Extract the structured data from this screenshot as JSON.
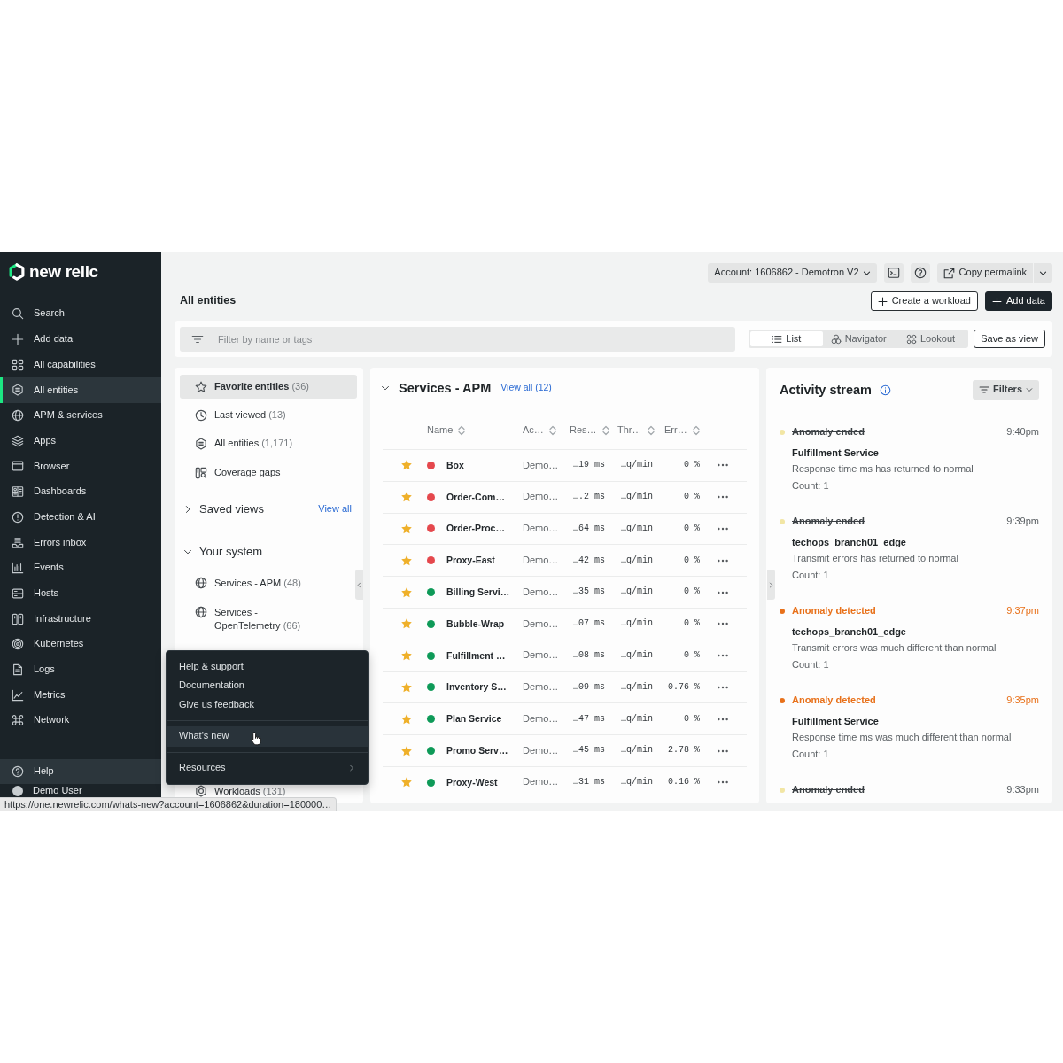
{
  "sidebar": {
    "brand": "new relic",
    "items": [
      {
        "label": "Search",
        "selected": false
      },
      {
        "label": "Add data",
        "selected": false
      },
      {
        "label": "All capabilities",
        "selected": false
      },
      {
        "label": "All entities",
        "selected": true
      },
      {
        "label": "APM & services",
        "selected": false
      },
      {
        "label": "Apps",
        "selected": false
      },
      {
        "label": "Browser",
        "selected": false
      },
      {
        "label": "Dashboards",
        "selected": false
      },
      {
        "label": "Detection & AI",
        "selected": false
      },
      {
        "label": "Errors inbox",
        "selected": false
      },
      {
        "label": "Events",
        "selected": false
      },
      {
        "label": "Hosts",
        "selected": false
      },
      {
        "label": "Infrastructure",
        "selected": false
      },
      {
        "label": "Kubernetes",
        "selected": false
      },
      {
        "label": "Logs",
        "selected": false
      },
      {
        "label": "Metrics",
        "selected": false
      },
      {
        "label": "Network",
        "selected": false
      }
    ],
    "footer": [
      {
        "label": "Help",
        "expanded": true
      },
      {
        "label": "Demo User",
        "expanded": false
      }
    ]
  },
  "top_bar": {
    "account": "Account: 1606862 - Demotron V2",
    "permalink": "Copy permalink"
  },
  "page": {
    "title": "All entities",
    "actions": [
      {
        "label": "Create a workload",
        "kind": "outline"
      },
      {
        "label": "Add data",
        "kind": "primary"
      }
    ]
  },
  "filter_bar": {
    "placeholder": "Filter by name or tags",
    "views": [
      {
        "label": "List",
        "selected": true
      },
      {
        "label": "Navigator",
        "selected": false
      },
      {
        "label": "Lookout",
        "selected": false
      }
    ],
    "save_button": "Save as view"
  },
  "entity_filters": {
    "quick": [
      {
        "label": "Favorite entities",
        "count": "(36)",
        "selected": true
      },
      {
        "label": "Last viewed",
        "count": "(13)",
        "selected": false
      },
      {
        "label": "All entities",
        "count": "(1,171)",
        "selected": false
      },
      {
        "label": "Coverage gaps",
        "selected": false
      }
    ],
    "sections": [
      {
        "title": "Saved views",
        "expanded": false,
        "link": "View all"
      },
      {
        "title": "Your system",
        "expanded": true,
        "items": [
          {
            "label": "Services - APM",
            "count": "(48)"
          },
          {
            "label": "Services - OpenTelemetry",
            "count": "(66)"
          },
          {
            "label": "Workloads",
            "count": "(131)"
          }
        ]
      }
    ]
  },
  "services": {
    "title": "Services - APM",
    "link": "View all (12)",
    "expanded": true,
    "columns": [
      "Name",
      "Ac…",
      "Res…",
      "Thr…",
      "Err…"
    ],
    "rows": [
      {
        "favorite": true,
        "color": "#e5484d",
        "name": "Box",
        "account": "Demo…",
        "response": "…19 ms",
        "throughput": "…q/min",
        "error": "0 %"
      },
      {
        "favorite": true,
        "color": "#e5484d",
        "name": "Order-Com…",
        "account": "Demo…",
        "response": "….2 ms",
        "throughput": "…q/min",
        "error": "0 %"
      },
      {
        "favorite": true,
        "color": "#e5484d",
        "name": "Order-Proc…",
        "account": "Demo…",
        "response": "…64 ms",
        "throughput": "…q/min",
        "error": "0 %"
      },
      {
        "favorite": true,
        "color": "#e5484d",
        "name": "Proxy-East",
        "account": "Demo…",
        "response": "…42 ms",
        "throughput": "…q/min",
        "error": "0 %"
      },
      {
        "favorite": true,
        "color": "#0e9a58",
        "name": "Billing Servi…",
        "account": "Demo…",
        "response": "…35 ms",
        "throughput": "…q/min",
        "error": "0 %"
      },
      {
        "favorite": true,
        "color": "#0e9a58",
        "name": "Bubble-Wrap",
        "account": "Demo…",
        "response": "…07 ms",
        "throughput": "…q/min",
        "error": "0 %"
      },
      {
        "favorite": true,
        "color": "#0e9a58",
        "name": "Fulfillment …",
        "account": "Demo…",
        "response": "…08 ms",
        "throughput": "…q/min",
        "error": "0 %"
      },
      {
        "favorite": true,
        "color": "#0e9a58",
        "name": "Inventory S…",
        "account": "Demo…",
        "response": "…09 ms",
        "throughput": "…q/min",
        "error": "0.76 %"
      },
      {
        "favorite": true,
        "color": "#0e9a58",
        "name": "Plan Service",
        "account": "Demo…",
        "response": "…47 ms",
        "throughput": "…q/min",
        "error": "0 %"
      },
      {
        "favorite": true,
        "color": "#0e9a58",
        "name": "Promo Serv…",
        "account": "Demo…",
        "response": "…45 ms",
        "throughput": "…q/min",
        "error": "2.78 %"
      },
      {
        "favorite": true,
        "color": "#0e9a58",
        "name": "Proxy-West",
        "account": "Demo…",
        "response": "…31 ms",
        "throughput": "…q/min",
        "error": "0.16 %"
      }
    ]
  },
  "activity": {
    "title": "Activity stream",
    "filter_button": "Filters",
    "events": [
      {
        "kind": "ended",
        "color": "#f2e6a4",
        "title": "Anomaly ended",
        "time": "9:40pm",
        "entity": "Fulfillment Service",
        "message": "Response time ms has returned to normal",
        "count": "Count: 1"
      },
      {
        "kind": "ended",
        "color": "#f2e6a4",
        "title": "Anomaly ended",
        "time": "9:39pm",
        "entity": "techops_branch01_edge",
        "message": "Transmit errors has returned to normal",
        "count": "Count: 1"
      },
      {
        "kind": "detected",
        "color": "#e8711a",
        "title": "Anomaly detected",
        "time": "9:37pm",
        "entity": "techops_branch01_edge",
        "message": "Transmit errors was much different than normal",
        "count": "Count: 1"
      },
      {
        "kind": "detected",
        "color": "#e8711a",
        "title": "Anomaly detected",
        "time": "9:35pm",
        "entity": "Fulfillment Service",
        "message": "Response time ms was much different than normal",
        "count": "Count: 1"
      },
      {
        "kind": "ended",
        "color": "#f2e6a4",
        "title": "Anomaly ended",
        "time": "9:33pm"
      }
    ]
  },
  "help_menu": {
    "groups": [
      [
        {
          "label": "Help & support",
          "selected": false,
          "submenu": false
        },
        {
          "label": "Documentation",
          "selected": false,
          "submenu": false
        },
        {
          "label": "Give us feedback",
          "selected": false,
          "submenu": false
        }
      ],
      [
        {
          "label": "What's new",
          "selected": true,
          "submenu": false
        }
      ],
      [
        {
          "label": "Resources",
          "selected": false,
          "submenu": true
        }
      ]
    ]
  },
  "status_bar": {
    "url": "https://one.newrelic.com/whats-new?account=1606862&duration=180000…"
  }
}
